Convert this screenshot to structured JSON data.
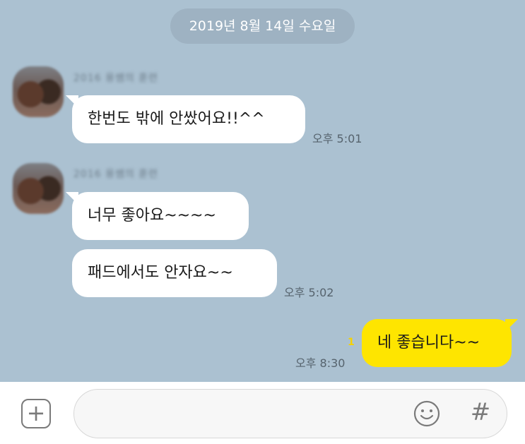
{
  "date_divider": "2019년 8월 14일 수요일",
  "messages": [
    {
      "sender": "2016 용쌤의 훈련",
      "text": "한번도 밖에 안쌌어요!!^^",
      "time": "오후 5:01"
    },
    {
      "sender": "2016 용쌤의 훈련",
      "texts": [
        "너무 좋아요~~~~",
        "패드에서도 안자요~~"
      ],
      "time": "오후 5:02"
    }
  ],
  "my_message": {
    "text": "네 좋습니다~~",
    "unread_count": "1",
    "time": "오후 8:30"
  },
  "input_bar": {
    "placeholder": "",
    "plus_icon": "plus-icon",
    "emoji_icon": "smiley-icon",
    "hash_symbol": "#"
  },
  "colors": {
    "chat_background": "#abc1d1",
    "my_bubble": "#fee500",
    "other_bubble": "#ffffff",
    "unread": "#f6d200"
  }
}
